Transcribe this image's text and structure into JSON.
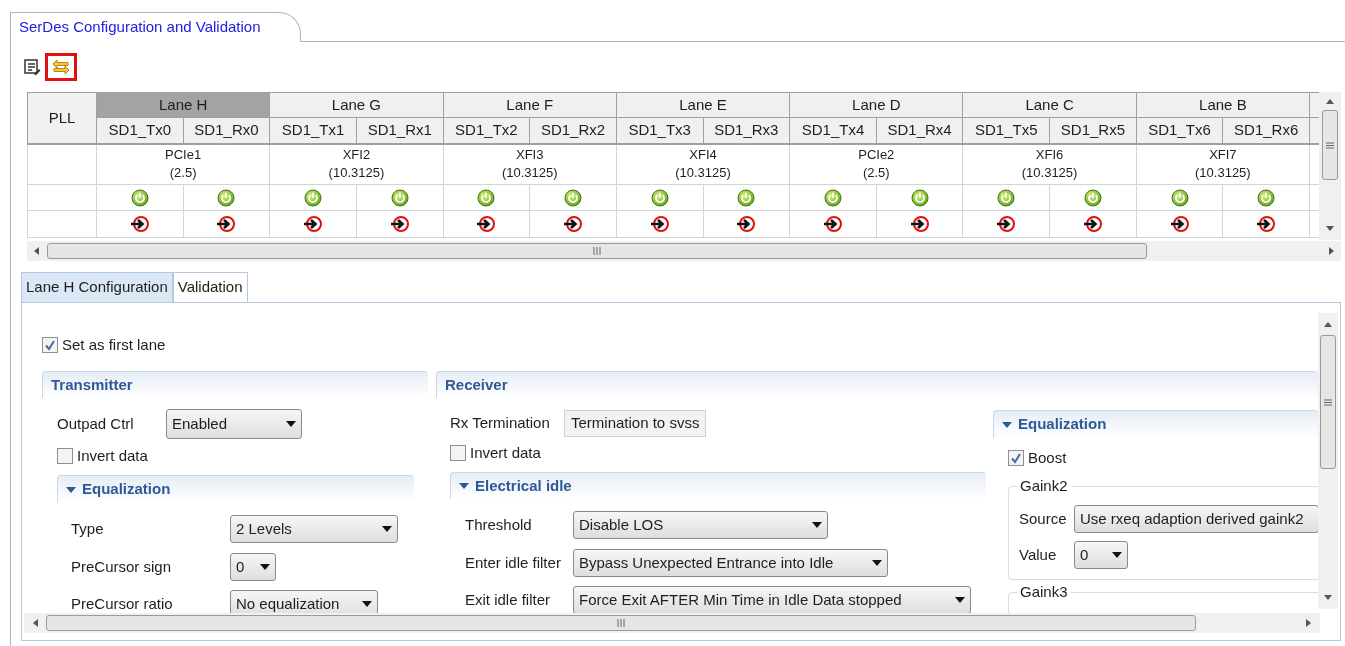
{
  "editor_tab": {
    "title": "SerDes Configuration and Validation"
  },
  "lane_table": {
    "pll_header": "PLL",
    "lanes": [
      {
        "name": "Lane H",
        "selected": true,
        "channels": [
          "SD1_Tx0",
          "SD1_Rx0"
        ],
        "protocol": "PCIe1",
        "rate": "(2.5)"
      },
      {
        "name": "Lane G",
        "selected": false,
        "channels": [
          "SD1_Tx1",
          "SD1_Rx1"
        ],
        "protocol": "XFI2",
        "rate": "(10.3125)"
      },
      {
        "name": "Lane F",
        "selected": false,
        "channels": [
          "SD1_Tx2",
          "SD1_Rx2"
        ],
        "protocol": "XFI3",
        "rate": "(10.3125)"
      },
      {
        "name": "Lane E",
        "selected": false,
        "channels": [
          "SD1_Tx3",
          "SD1_Rx3"
        ],
        "protocol": "XFI4",
        "rate": "(10.3125)"
      },
      {
        "name": "Lane D",
        "selected": false,
        "channels": [
          "SD1_Tx4",
          "SD1_Rx4"
        ],
        "protocol": "PCIe2",
        "rate": "(2.5)"
      },
      {
        "name": "Lane C",
        "selected": false,
        "channels": [
          "SD1_Tx5",
          "SD1_Rx5"
        ],
        "protocol": "XFI6",
        "rate": "(10.3125)"
      },
      {
        "name": "Lane B",
        "selected": false,
        "channels": [
          "SD1_Tx6",
          "SD1_Rx6"
        ],
        "protocol": "XFI7",
        "rate": "(10.3125)"
      }
    ]
  },
  "config_tabs": [
    {
      "label": "Lane H Configuration",
      "selected": true
    },
    {
      "label": "Validation",
      "selected": false
    }
  ],
  "set_first_lane": {
    "label": "Set as first lane",
    "checked": true
  },
  "transmitter": {
    "title": "Transmitter",
    "outpad_ctrl": {
      "label": "Outpad Ctrl",
      "value": "Enabled"
    },
    "invert_data": {
      "label": "Invert data",
      "checked": false
    },
    "equalization": {
      "title": "Equalization",
      "expanded": true,
      "fields": [
        {
          "label": "Type",
          "value": "2 Levels"
        },
        {
          "label": "PreCursor sign",
          "value": "0"
        },
        {
          "label": "PreCursor ratio",
          "value": "No equalization"
        }
      ]
    }
  },
  "receiver": {
    "title": "Receiver",
    "rx_termination": {
      "label": "Rx Termination",
      "value": "Termination to svss"
    },
    "invert_data": {
      "label": "Invert data",
      "checked": false
    },
    "electrical_idle": {
      "title": "Electrical idle",
      "expanded": true,
      "fields": [
        {
          "label": "Threshold",
          "value": "Disable LOS"
        },
        {
          "label": "Enter idle filter",
          "value": "Bypass Unexpected Entrance into Idle"
        },
        {
          "label": "Exit idle filter",
          "value": "Force Exit AFTER Min Time in Idle Data stopped"
        }
      ]
    },
    "equalization": {
      "title": "Equalization",
      "expanded": true,
      "boost": {
        "label": "Boost",
        "checked": true
      },
      "groups": [
        {
          "title": "Gaink2",
          "fields": [
            {
              "label": "Source",
              "value": "Use rxeq adaption derived gaink2"
            },
            {
              "label": "Value",
              "value": "0"
            }
          ]
        },
        {
          "title": "Gaink3"
        }
      ]
    }
  }
}
